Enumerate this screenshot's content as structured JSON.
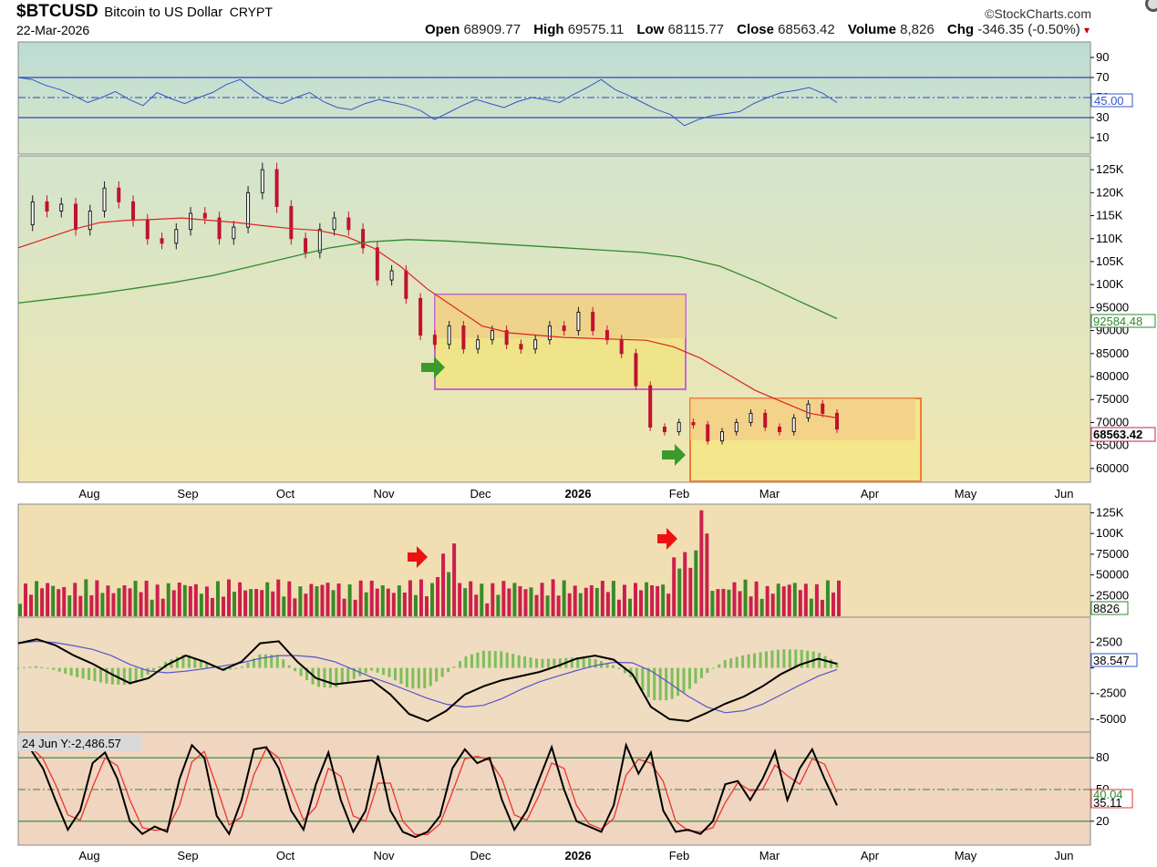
{
  "header": {
    "symbol": "$BTCUSD",
    "description": "Bitcoin to US Dollar",
    "exchange": "CRYPT",
    "date": "22-Mar-2026",
    "brand": "©StockCharts.com",
    "open_label": "Open",
    "open": "68909.77",
    "high_label": "High",
    "high": "69575.11",
    "low_label": "Low",
    "low": "68115.77",
    "close_label": "Close",
    "close": "68563.42",
    "volume_label": "Volume",
    "volume": "8,826",
    "chg_label": "Chg",
    "chg": "-346.35 (-0.50%)",
    "chg_arrow": "▾"
  },
  "colors": {
    "rsi_bg": "#bfe0d8",
    "price_bg_top": "#d6e6c8",
    "price_bg_bottom": "#efe7b3",
    "volume_bg": "#f1dfb3",
    "macd_bg": "#f0dcc0",
    "stoch_bg": "#f0d5c0",
    "up": "#3a8a2a",
    "down": "#cc1f4e",
    "rsi_line": "#3355cc",
    "sma50": "#dd2222",
    "sma200": "#2f8a2f",
    "macd_line": "#000000",
    "macd_signal": "#5555cc",
    "stoch_signal": "#ee3333",
    "box1_border": "#c266d8",
    "box2_border": "#f07b36",
    "arrow_green": "#3b9a2b",
    "arrow_red": "#ee1111"
  },
  "chart_data": [
    {
      "type": "line",
      "panel": "RSI",
      "y_ticks": [
        "90",
        "70",
        "50",
        "30",
        "10"
      ],
      "ylim": [
        0,
        100
      ],
      "lines": [
        70,
        30
      ],
      "midline": 50,
      "last_value": "45.00",
      "series": [
        {
          "values": [
            70,
            68,
            62,
            58,
            52,
            45,
            50,
            56,
            48,
            42,
            55,
            49,
            44,
            50,
            55,
            63,
            68,
            57,
            48,
            44,
            50,
            55,
            46,
            40,
            38,
            44,
            48,
            45,
            42,
            37,
            28,
            35,
            42,
            48,
            44,
            40,
            46,
            50,
            48,
            45,
            53,
            60,
            68,
            58,
            52,
            45,
            38,
            33,
            22,
            28,
            32,
            34,
            36,
            44,
            50,
            55,
            57,
            60,
            54,
            45
          ]
        }
      ]
    },
    {
      "type": "line",
      "panel": "Price",
      "x_ticks": [
        "Aug",
        "Sep",
        "Oct",
        "Nov",
        "Dec",
        "2026",
        "Feb",
        "Mar",
        "Apr",
        "May",
        "Jun"
      ],
      "y_ticks": [
        "125K",
        "120K",
        "115K",
        "110K",
        "105K",
        "100K",
        "95000",
        "90000",
        "85000",
        "80000",
        "75000",
        "70000",
        "65000",
        "60000"
      ],
      "ylim": [
        57000,
        128000
      ],
      "series": [
        {
          "values": [
            113000,
            118000,
            116000,
            117500,
            112000,
            116000,
            121000,
            118000,
            114000,
            110000,
            109000,
            112000,
            115500,
            114500,
            110000,
            112500,
            120000,
            125000,
            117000,
            110000,
            107000,
            112000,
            114500,
            112000,
            108000,
            101000,
            103000,
            97000,
            89000,
            87000,
            91000,
            86000,
            88000,
            90000,
            87000,
            86000,
            88000,
            91000,
            90000,
            94000,
            90000,
            88000,
            85000,
            78000,
            69000,
            68000,
            70000,
            69500,
            66000,
            68000,
            70000,
            72000,
            69000,
            68000,
            71000,
            74000,
            72000,
            68563
          ]
        },
        {
          "name": "",
          "values": [
            108000,
            110000,
            112000,
            113500,
            114000,
            114200,
            114500,
            114000,
            113500,
            112800,
            112200,
            111800,
            110500,
            108000,
            104000,
            99000,
            95000,
            91000,
            89500,
            89000,
            88500,
            88300,
            88100,
            87900,
            86500,
            84000,
            80500,
            77000,
            74500,
            72000,
            71000
          ]
        },
        {
          "name": "",
          "values": [
            96000,
            97000,
            98000,
            99200,
            100500,
            102000,
            104000,
            106000,
            108000,
            109300,
            109800,
            109500,
            109000,
            108500,
            108000,
            107500,
            107000,
            106000,
            104000,
            100500,
            96500,
            92600
          ]
        }
      ],
      "last_close": "68563.42",
      "sma200_value": "92584.48"
    },
    {
      "type": "bar",
      "panel": "Volume",
      "y_ticks": [
        "125K",
        "100K",
        "75000",
        "50000",
        "25000"
      ],
      "ylim": [
        0,
        130000
      ],
      "last_value": "8826"
    },
    {
      "type": "line",
      "panel": "MACD",
      "y_ticks": [
        "2500",
        "0",
        "-2500",
        "-5000"
      ],
      "ylim": [
        -6000,
        4500
      ],
      "last_value": "38.547"
    },
    {
      "type": "line",
      "panel": "Stochastic",
      "y_ticks": [
        "80",
        "50",
        "20"
      ],
      "ylim": [
        0,
        100
      ],
      "lines": [
        80,
        20
      ],
      "midline": 50,
      "crosshair_label": "24 Jun Y:-2,486.57",
      "last_value": "35.11",
      "last_value_2": "40.04"
    }
  ]
}
